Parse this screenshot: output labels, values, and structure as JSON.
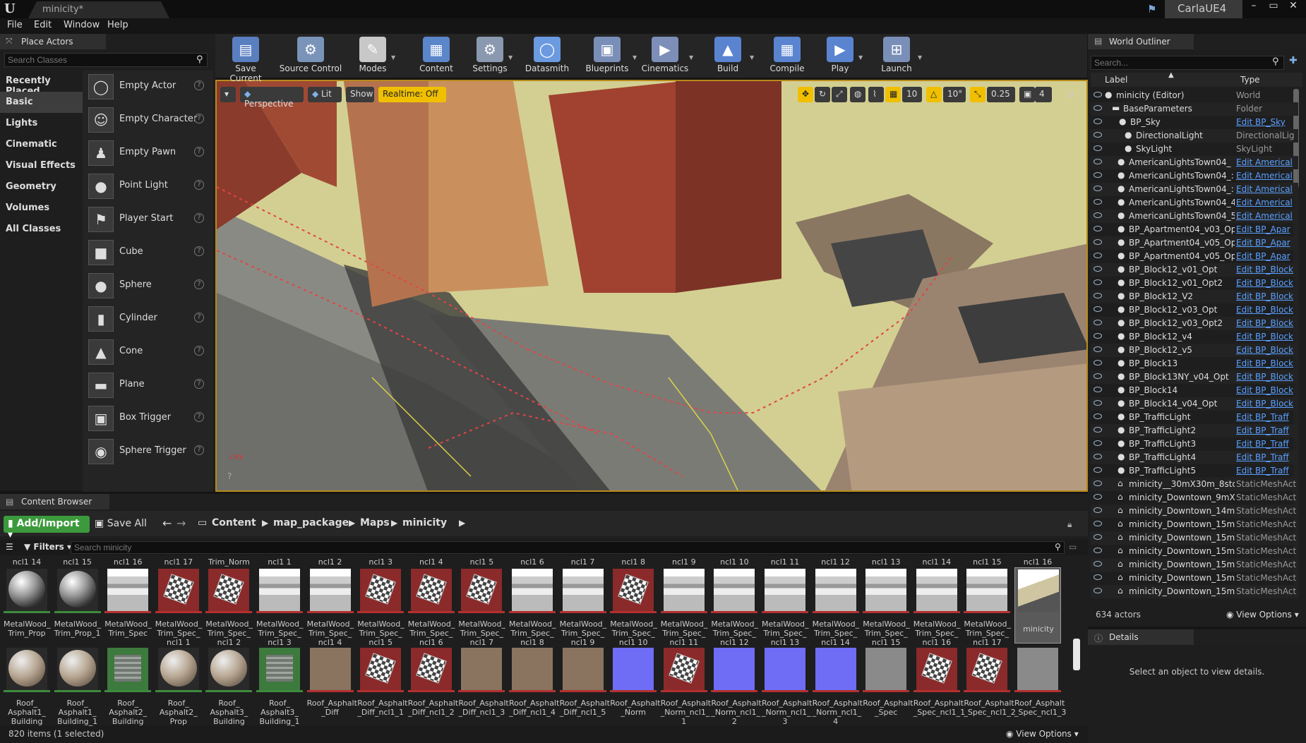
{
  "window": {
    "doc_tab": "minicity*",
    "app_name": "CarlaUE4",
    "min": "–",
    "max": "▭",
    "close": "✕"
  },
  "menu": [
    "File",
    "Edit",
    "Window",
    "Help"
  ],
  "place_actors": {
    "title": "Place Actors",
    "search_placeholder": "Search Classes",
    "categories": [
      "Recently Placed",
      "Basic",
      "Lights",
      "Cinematic",
      "Visual Effects",
      "Geometry",
      "Volumes",
      "All Classes"
    ],
    "selected_category": "Basic",
    "items": [
      "Empty Actor",
      "Empty Character",
      "Empty Pawn",
      "Point Light",
      "Player Start",
      "Cube",
      "Sphere",
      "Cylinder",
      "Cone",
      "Plane",
      "Box Trigger",
      "Sphere Trigger"
    ]
  },
  "toolbar": [
    {
      "label": "Save Current",
      "icon": "save-icon"
    },
    {
      "label": "Source Control",
      "icon": "source-control-icon"
    },
    {
      "label": "Modes",
      "icon": "modes-icon"
    },
    {
      "label": "Content",
      "icon": "content-icon"
    },
    {
      "label": "Settings",
      "icon": "settings-icon"
    },
    {
      "label": "Datasmith",
      "icon": "datasmith-icon"
    },
    {
      "label": "Blueprints",
      "icon": "blueprints-icon"
    },
    {
      "label": "Cinematics",
      "icon": "cinematics-icon"
    },
    {
      "label": "Build",
      "icon": "build-icon"
    },
    {
      "label": "Compile",
      "icon": "compile-icon"
    },
    {
      "label": "Play",
      "icon": "play-icon"
    },
    {
      "label": "Launch",
      "icon": "launch-icon"
    }
  ],
  "viewport": {
    "perspective": "Perspective",
    "lit": "Lit",
    "show": "Show",
    "realtime": "Realtime: Off",
    "grid_snap": "10",
    "rot_snap": "10°",
    "scale_snap": "0.25",
    "camera_speed": "4"
  },
  "outliner": {
    "title": "World Outliner",
    "search_placeholder": "Search...",
    "col_label": "Label",
    "col_type": "Type",
    "rows": [
      {
        "label": "minicity (Editor)",
        "type": "World",
        "link": false
      },
      {
        "label": "BaseParameters",
        "type": "Folder",
        "link": false
      },
      {
        "label": "BP_Sky",
        "type": "Edit BP_Sky",
        "link": true
      },
      {
        "label": "DirectionalLight",
        "type": "DirectionalLig",
        "link": false
      },
      {
        "label": "SkyLight",
        "type": "SkyLight",
        "link": false
      },
      {
        "label": "AmericanLightsTown04_",
        "type": "Edit Americal",
        "link": true
      },
      {
        "label": "AmericanLightsTown04_:",
        "type": "Edit Americal",
        "link": true
      },
      {
        "label": "AmericanLightsTown04_:",
        "type": "Edit Americal",
        "link": true
      },
      {
        "label": "AmericanLightsTown04_4",
        "type": "Edit Americal",
        "link": true
      },
      {
        "label": "AmericanLightsTown04_5",
        "type": "Edit Americal",
        "link": true
      },
      {
        "label": "BP_Apartment04_v03_Op",
        "type": "Edit BP_Apar",
        "link": true
      },
      {
        "label": "BP_Apartment04_v05_Op",
        "type": "Edit BP_Apar",
        "link": true
      },
      {
        "label": "BP_Apartment04_v05_Op",
        "type": "Edit BP_Apar",
        "link": true
      },
      {
        "label": "BP_Block12_v01_Opt",
        "type": "Edit BP_Block",
        "link": true
      },
      {
        "label": "BP_Block12_v01_Opt2",
        "type": "Edit BP_Block",
        "link": true
      },
      {
        "label": "BP_Block12_V2",
        "type": "Edit BP_Block",
        "link": true
      },
      {
        "label": "BP_Block12_v03_Opt",
        "type": "Edit BP_Block",
        "link": true
      },
      {
        "label": "BP_Block12_v03_Opt2",
        "type": "Edit BP_Block",
        "link": true
      },
      {
        "label": "BP_Block12_v4",
        "type": "Edit BP_Block",
        "link": true
      },
      {
        "label": "BP_Block12_v5",
        "type": "Edit BP_Block",
        "link": true
      },
      {
        "label": "BP_Block13",
        "type": "Edit BP_Block",
        "link": true
      },
      {
        "label": "BP_Block13NY_v04_Opt",
        "type": "Edit BP_Block",
        "link": true
      },
      {
        "label": "BP_Block14",
        "type": "Edit BP_Block",
        "link": true
      },
      {
        "label": "BP_Block14_v04_Opt",
        "type": "Edit BP_Block",
        "link": true
      },
      {
        "label": "BP_TrafficLight",
        "type": "Edit BP_Traff",
        "link": true
      },
      {
        "label": "BP_TrafficLight2",
        "type": "Edit BP_Traff",
        "link": true
      },
      {
        "label": "BP_TrafficLight3",
        "type": "Edit BP_Traff",
        "link": true
      },
      {
        "label": "BP_TrafficLight4",
        "type": "Edit BP_Traff",
        "link": true
      },
      {
        "label": "BP_TrafficLight5",
        "type": "Edit BP_Traff",
        "link": true
      },
      {
        "label": "minicity__30mX30m_8sto",
        "type": "StaticMeshAct",
        "link": false
      },
      {
        "label": "minicity_Downtown_9mX",
        "type": "StaticMeshAct",
        "link": false
      },
      {
        "label": "minicity_Downtown_14m",
        "type": "StaticMeshAct",
        "link": false
      },
      {
        "label": "minicity_Downtown_15m",
        "type": "StaticMeshAct",
        "link": false
      },
      {
        "label": "minicity_Downtown_15m",
        "type": "StaticMeshAct",
        "link": false
      },
      {
        "label": "minicity_Downtown_15m",
        "type": "StaticMeshAct",
        "link": false
      },
      {
        "label": "minicity_Downtown_15m",
        "type": "StaticMeshAct",
        "link": false
      },
      {
        "label": "minicity_Downtown_15m",
        "type": "StaticMeshAct",
        "link": false
      },
      {
        "label": "minicity_Downtown_15m",
        "type": "StaticMeshAct",
        "link": false
      }
    ],
    "actor_count": "634 actors",
    "view_options": "View Options"
  },
  "details": {
    "title": "Details",
    "empty": "Select an object to view details."
  },
  "content_browser": {
    "title": "Content Browser",
    "add_import": "Add/Import",
    "save_all": "Save All",
    "path": [
      "Content",
      "map_package",
      "Maps",
      "minicity"
    ],
    "filters": "Filters",
    "search_placeholder": "Search minicity",
    "item_count": "820 items (1 selected)",
    "view_options": "View Options",
    "top_cut": [
      "ncl1 14",
      "ncl1 15",
      "ncl1 16",
      "ncl1 17",
      "Trim_Norm",
      "ncl1 1",
      "ncl1 2",
      "ncl1 3",
      "ncl1 4",
      "ncl1 5",
      "ncl1 6",
      "ncl1 7",
      "ncl1 8",
      "ncl1 9",
      "ncl1 10",
      "ncl1 11",
      "ncl1 12",
      "ncl1 13",
      "ncl1 14",
      "ncl1 15",
      "ncl1 16"
    ],
    "row1": [
      {
        "name": "MetalWood_ Trim_Prop",
        "kind": "ball1"
      },
      {
        "name": "MetalWood_ Trim_Prop_1",
        "kind": "ball1"
      },
      {
        "name": "MetalWood_ Trim_Spec",
        "kind": "trim"
      },
      {
        "name": "MetalWood_ Trim_Spec_ ncl1 1",
        "kind": "checker"
      },
      {
        "name": "MetalWood_ Trim_Spec_ ncl1 2",
        "kind": "checker"
      },
      {
        "name": "MetalWood_ Trim_Spec_ ncl1 3",
        "kind": "trim"
      },
      {
        "name": "MetalWood_ Trim_Spec_ ncl1 4",
        "kind": "trim"
      },
      {
        "name": "MetalWood_ Trim_Spec_ ncl1 5",
        "kind": "checker"
      },
      {
        "name": "MetalWood_ Trim_Spec_ ncl1 6",
        "kind": "checker"
      },
      {
        "name": "MetalWood_ Trim_Spec_ ncl1 7",
        "kind": "checker"
      },
      {
        "name": "MetalWood_ Trim_Spec_ ncl1 8",
        "kind": "trim"
      },
      {
        "name": "MetalWood_ Trim_Spec_ ncl1 9",
        "kind": "trim"
      },
      {
        "name": "MetalWood_ Trim_Spec_ ncl1 10",
        "kind": "checker"
      },
      {
        "name": "MetalWood_ Trim_Spec_ ncl1 11",
        "kind": "trim"
      },
      {
        "name": "MetalWood_ Trim_Spec_ ncl1 12",
        "kind": "trim"
      },
      {
        "name": "MetalWood_ Trim_Spec_ ncl1 13",
        "kind": "trim"
      },
      {
        "name": "MetalWood_ Trim_Spec_ ncl1 14",
        "kind": "trim"
      },
      {
        "name": "MetalWood_ Trim_Spec_ ncl1 15",
        "kind": "trim"
      },
      {
        "name": "MetalWood_ Trim_Spec_ ncl1 16",
        "kind": "trim"
      },
      {
        "name": "MetalWood_ Trim_Spec_ ncl1 17",
        "kind": "trim"
      },
      {
        "name": "minicity",
        "kind": "map"
      }
    ],
    "row2": [
      {
        "name": "Roof_ Asphalt1_ Building",
        "kind": "ball2"
      },
      {
        "name": "Roof_ Asphalt1_ Building_1",
        "kind": "ball2"
      },
      {
        "name": "Roof_ Asphalt2_ Building",
        "kind": "grid"
      },
      {
        "name": "Roof_ Asphalt2_ Prop",
        "kind": "ball2"
      },
      {
        "name": "Roof_ Asphalt3_ Building",
        "kind": "ball2"
      },
      {
        "name": "Roof_ Asphalt3_ Building_1",
        "kind": "grid"
      },
      {
        "name": "Roof_Asphalt _Diff",
        "kind": "flat"
      },
      {
        "name": "Roof_Asphalt _Diff_ncl1_1",
        "kind": "checker"
      },
      {
        "name": "Roof_Asphalt _Diff_ncl1_2",
        "kind": "checker"
      },
      {
        "name": "Roof_Asphalt _Diff_ncl1_3",
        "kind": "flat"
      },
      {
        "name": "Roof_Asphalt _Diff_ncl1_4",
        "kind": "flat"
      },
      {
        "name": "Roof_Asphalt _Diff_ncl1_5",
        "kind": "flat"
      },
      {
        "name": "Roof_Asphalt _Norm",
        "kind": "blue"
      },
      {
        "name": "Roof_Asphalt _Norm_ncl1_ 1",
        "kind": "checker"
      },
      {
        "name": "Roof_Asphalt _Norm_ncl1_ 2",
        "kind": "blue"
      },
      {
        "name": "Roof_Asphalt _Norm_ncl1_ 3",
        "kind": "blue"
      },
      {
        "name": "Roof_Asphalt _Norm_ncl1_ 4",
        "kind": "blue"
      },
      {
        "name": "Roof_Asphalt _Spec",
        "kind": "grey"
      },
      {
        "name": "Roof_Asphalt _Spec_ncl1_1",
        "kind": "checker"
      },
      {
        "name": "Roof_Asphalt _Spec_ncl1_2",
        "kind": "checker"
      },
      {
        "name": "Roof_Asphalt _Spec_ncl1_3",
        "kind": "grey"
      }
    ]
  }
}
